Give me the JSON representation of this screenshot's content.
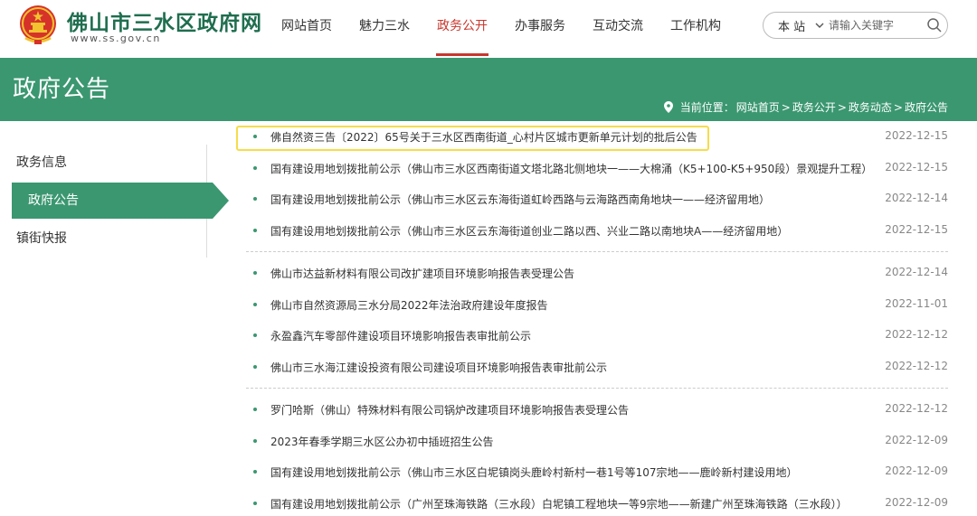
{
  "header": {
    "site_title": "佛山市三水区政府网",
    "site_url": "www.ss.gov.cn",
    "nav": [
      {
        "label": "网站首页",
        "active": false
      },
      {
        "label": "魅力三水",
        "active": false
      },
      {
        "label": "政务公开",
        "active": true
      },
      {
        "label": "办事服务",
        "active": false
      },
      {
        "label": "互动交流",
        "active": false
      },
      {
        "label": "工作机构",
        "active": false
      }
    ],
    "search": {
      "scope": "本 站",
      "placeholder": "请输入关键字"
    }
  },
  "banner": {
    "title": "政府公告",
    "breadcrumb_prefix": "当前位置：",
    "breadcrumb": [
      "网站首页",
      "政务公开",
      "政务动态",
      "政府公告"
    ],
    "separator": ">"
  },
  "sidebar": {
    "items": [
      {
        "label": "政务信息",
        "active": false
      },
      {
        "label": "政府公告",
        "active": true
      },
      {
        "label": "镇街快报",
        "active": false
      }
    ]
  },
  "news": {
    "groups": [
      [
        {
          "title": "佛自然资三告〔2022〕65号关于三水区西南街道_心村片区城市更新单元计划的批后公告",
          "date": "2022-12-15",
          "highlight": true
        },
        {
          "title": "国有建设用地划拨批前公示（佛山市三水区西南街道文塔北路北侧地块一——大棉涌（K5+100-K5+950段）景观提升工程）",
          "date": "2022-12-15"
        },
        {
          "title": "国有建设用地划拨批前公示（佛山市三水区云东海街道虹岭西路与云海路西南角地块一——经济留用地）",
          "date": "2022-12-14"
        },
        {
          "title": "国有建设用地划拨批前公示（佛山市三水区云东海街道创业二路以西、兴业二路以南地块A——经济留用地）",
          "date": "2022-12-15"
        }
      ],
      [
        {
          "title": "佛山市达益新材料有限公司改扩建项目环境影响报告表受理公告",
          "date": "2022-12-14"
        },
        {
          "title": "佛山市自然资源局三水分局2022年法治政府建设年度报告",
          "date": "2022-11-01"
        },
        {
          "title": "永盈鑫汽车零部件建设项目环境影响报告表审批前公示",
          "date": "2022-12-12"
        },
        {
          "title": "佛山市三水海江建设投资有限公司建设项目环境影响报告表审批前公示",
          "date": "2022-12-12"
        }
      ],
      [
        {
          "title": "罗门哈斯（佛山）特殊材料有限公司锅炉改建项目环境影响报告表受理公告",
          "date": "2022-12-12"
        },
        {
          "title": "2023年春季学期三水区公办初中插班招生公告",
          "date": "2022-12-09"
        },
        {
          "title": "国有建设用地划拨批前公示（佛山市三水区白坭镇岗头鹿岭村新村一巷1号等107宗地——鹿岭新村建设用地）",
          "date": "2022-12-09"
        },
        {
          "title": "国有建设用地划拨批前公示（广州至珠海铁路（三水段）白坭镇工程地块一等9宗地——新建广州至珠海铁路（三水段））",
          "date": "2022-12-09"
        }
      ]
    ]
  },
  "colors": {
    "brand_green": "#3b9770",
    "title_green": "#1f6e4f",
    "active_red": "#c8372d",
    "highlight_yellow": "#f5dc4b"
  },
  "icons": [
    "national-emblem-icon",
    "chevron-down-icon",
    "search-icon",
    "location-pin-icon"
  ]
}
